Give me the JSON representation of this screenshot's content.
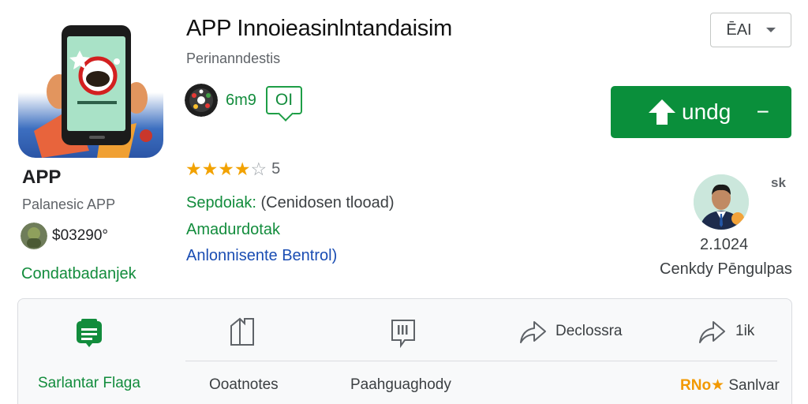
{
  "app": {
    "title": "APP Innoieasinlntandaisim",
    "subtitle": "Perinanndestis",
    "short_name": "APP",
    "category": "Palanesic APP",
    "price": "$03290°",
    "link": "Condatbadanjek"
  },
  "badge": {
    "text": "6m9",
    "box_label": "OI"
  },
  "rating": {
    "value": "5",
    "stars_filled": 4,
    "stars_total": 5
  },
  "details": {
    "label": "Sepdoiak:",
    "value": " (Cenidosen tlooad)",
    "line2": "Amadurdotak",
    "line3": "Anlonnisente Bentrol)"
  },
  "lang_select": {
    "label": "ĒAI"
  },
  "install": {
    "label": "undg",
    "trailing": "−"
  },
  "author": {
    "close": "sk",
    "year": "2.1024",
    "name": "Cenkdy Pēngulpas"
  },
  "actions": {
    "share_label": "Declossra",
    "forward_label": "1ik",
    "wishlist_label": "Sarlantar Flaga",
    "notes_label": "Ooatnotes",
    "page_label": "Paahguaghody",
    "save_prefix": "RNo★",
    "save_label": " Sanlvar"
  },
  "colors": {
    "green": "#0a8f3b",
    "star": "#f2a200",
    "link_blue": "#1a4db3"
  },
  "icons": [
    "phone-app-icon",
    "developer-avatar",
    "badge-icon",
    "star-icon",
    "chevron-down-icon",
    "upload-arrow-icon",
    "author-avatar",
    "close-icon",
    "wishlist-icon",
    "bookmark-icon",
    "page-icon",
    "share-icon",
    "forward-icon"
  ]
}
